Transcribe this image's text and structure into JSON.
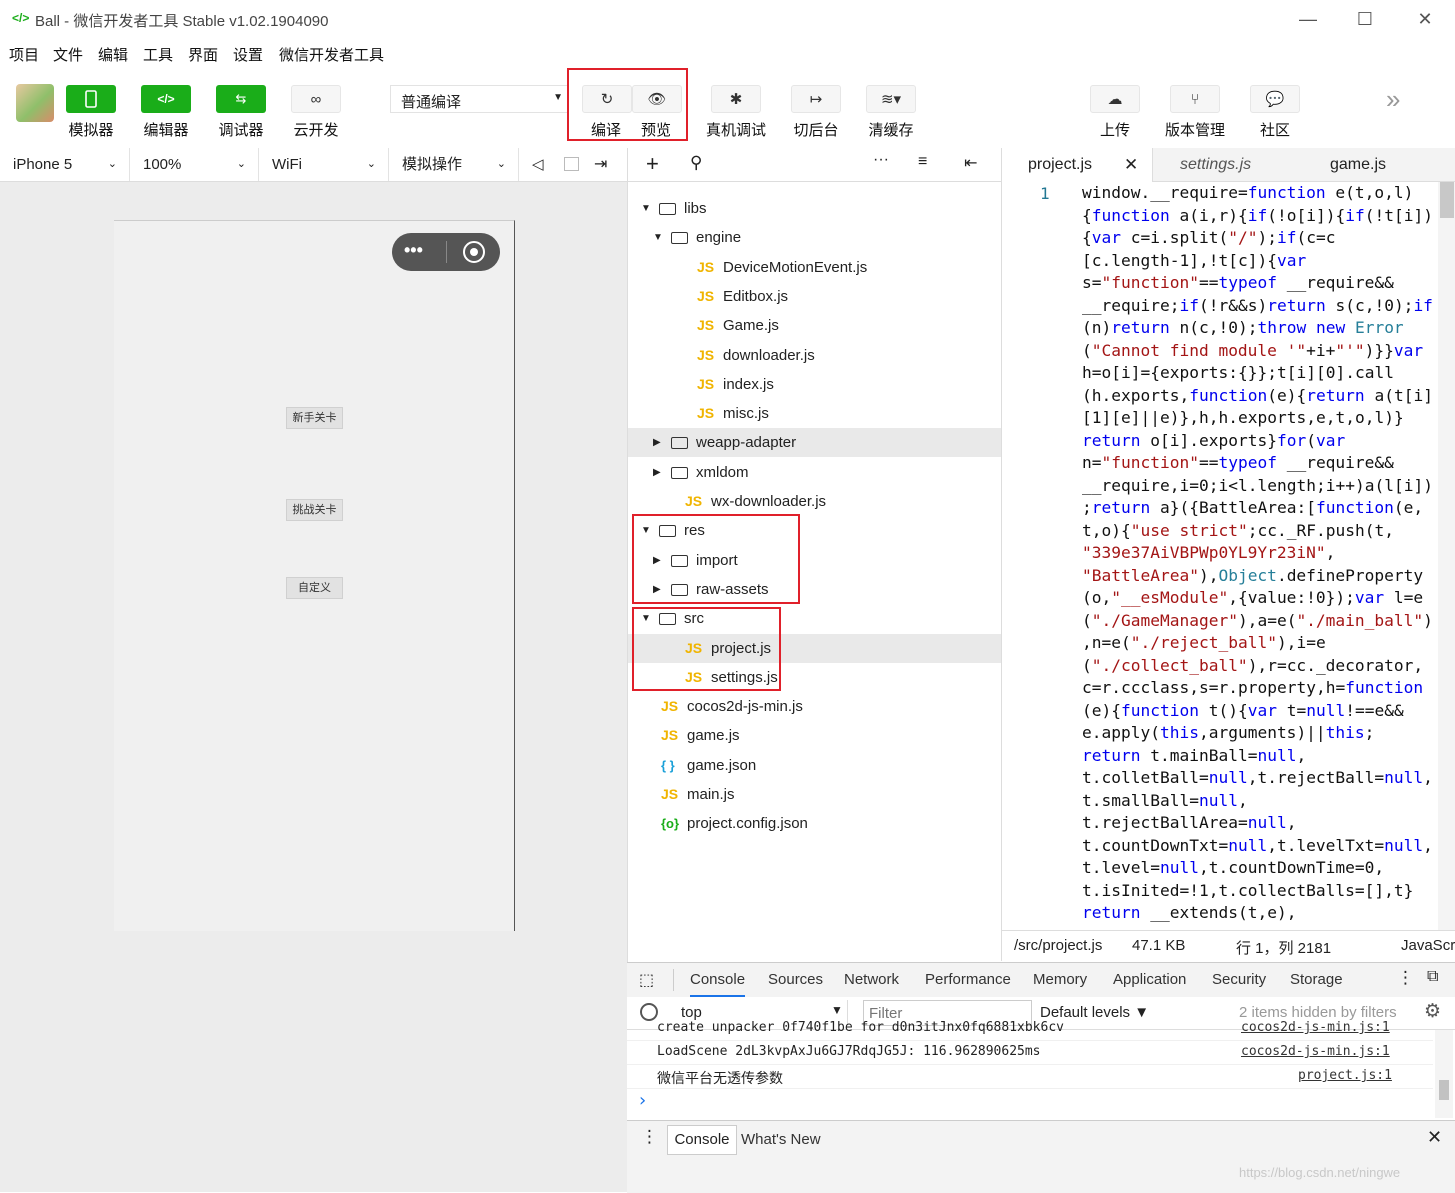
{
  "window": {
    "logo": "</>",
    "title": "Ball - 微信开发者工具 Stable v1.02.1904090",
    "minimize": "—",
    "maximize": "☐",
    "close": "✕"
  },
  "menu": [
    "项目",
    "文件",
    "编辑",
    "工具",
    "界面",
    "设置",
    "微信开发者工具"
  ],
  "toolbar": {
    "simulator": "模拟器",
    "editor": "编辑器",
    "debugger": "调试器",
    "cloud": "云开发",
    "compile_mode": "普通编译",
    "compile": "编译",
    "preview": "预览",
    "remote_debug": "真机调试",
    "background": "切后台",
    "clear_cache": "清缓存",
    "upload": "上传",
    "version": "版本管理",
    "community": "社区",
    "more": "»"
  },
  "simbar": {
    "device": "iPhone 5",
    "zoom": "100%",
    "network": "WiFi",
    "operation": "模拟操作"
  },
  "phone": {
    "capsule_dots": "•••",
    "buttons": [
      "新手关卡",
      "挑战关卡",
      "自定义"
    ]
  },
  "tree": [
    {
      "label": "libs",
      "type": "folder",
      "open": true,
      "depth": 0
    },
    {
      "label": "engine",
      "type": "folder",
      "open": true,
      "depth": 1
    },
    {
      "label": "DeviceMotionEvent.js",
      "type": "js",
      "depth": 2
    },
    {
      "label": "Editbox.js",
      "type": "js",
      "depth": 2
    },
    {
      "label": "Game.js",
      "type": "js",
      "depth": 2
    },
    {
      "label": "downloader.js",
      "type": "js",
      "depth": 2
    },
    {
      "label": "index.js",
      "type": "js",
      "depth": 2
    },
    {
      "label": "misc.js",
      "type": "js",
      "depth": 2
    },
    {
      "label": "weapp-adapter",
      "type": "folder",
      "open": false,
      "depth": 1,
      "highlight": true
    },
    {
      "label": "xmldom",
      "type": "folder",
      "open": false,
      "depth": 1
    },
    {
      "label": "wx-downloader.js",
      "type": "js",
      "depth": 1
    },
    {
      "label": "res",
      "type": "folder",
      "open": true,
      "depth": 0
    },
    {
      "label": "import",
      "type": "folder",
      "open": false,
      "depth": 1
    },
    {
      "label": "raw-assets",
      "type": "folder",
      "open": false,
      "depth": 1
    },
    {
      "label": "src",
      "type": "folder",
      "open": true,
      "depth": 0
    },
    {
      "label": "project.js",
      "type": "js",
      "depth": 1,
      "highlight": true
    },
    {
      "label": "settings.js",
      "type": "js",
      "depth": 1
    },
    {
      "label": "cocos2d-js-min.js",
      "type": "js",
      "depth": 0
    },
    {
      "label": "game.js",
      "type": "js",
      "depth": 0
    },
    {
      "label": "game.json",
      "type": "json",
      "depth": 0
    },
    {
      "label": "main.js",
      "type": "js",
      "depth": 0
    },
    {
      "label": "project.config.json",
      "type": "config",
      "depth": 0
    }
  ],
  "editor": {
    "tabs": [
      "project.js",
      "settings.js",
      "game.js"
    ],
    "line_number": "1",
    "code_lines": [
      "window.__require=function e(t,o,l)",
      "{function a(i,r){if(!o[i]){if(!t[i])",
      "{var c=i.split(\"/\");if(c=c",
      "[c.length-1],!t[c]){var",
      "s=\"function\"==typeof __require&&",
      "__require;if(!r&&s)return s(c,!0);if",
      "(n)return n(c,!0);throw new Error",
      "(\"Cannot find module '\"+i+\"'\")}}var",
      "h=o[i]={exports:{}};t[i][0].call",
      "(h.exports,function(e){return a(t[i]",
      "[1][e]||e)},h,h.exports,e,t,o,l)}",
      "return o[i].exports}for(var",
      "n=\"function\"==typeof __require&&",
      "__require,i=0;i<l.length;i++)a(l[i])",
      ";return a}({BattleArea:[function(e,",
      "t,o){\"use strict\";cc._RF.push(t,",
      "\"339e37AiVBPWp0YL9Yr23iN\",",
      "\"BattleArea\"),Object.defineProperty",
      "(o,\"__esModule\",{value:!0});var l=e",
      "(\"./GameManager\"),a=e(\"./main_ball\")",
      ",n=e(\"./reject_ball\"),i=e",
      "(\"./collect_ball\"),r=cc._decorator,",
      "c=r.ccclass,s=r.property,h=function",
      "(e){function t(){var t=null!==e&&",
      "e.apply(this,arguments)||this;",
      "return t.mainBall=null,",
      "t.colletBall=null,t.rejectBall=null,",
      "t.smallBall=null,",
      "t.rejectBallArea=null,",
      "t.countDownTxt=null,t.levelTxt=null,",
      "t.level=null,t.countDownTime=0,",
      "t.isInited=!1,t.collectBalls=[],t}",
      "return __extends(t,e),"
    ]
  },
  "status": {
    "path": "/src/project.js",
    "size": "47.1 KB",
    "position": "行 1，列 2181",
    "language": "JavaScr"
  },
  "devtools": {
    "tabs": [
      "Console",
      "Sources",
      "Network",
      "Performance",
      "Memory",
      "Application",
      "Security",
      "Storage"
    ],
    "context": "top",
    "filter_placeholder": "Filter",
    "levels": "Default levels ▼",
    "hidden": "2 items hidden by filters",
    "messages": [
      {
        "text": "create unpacker 0f740f1be for d0n3itJnx0fq6881xbk6cv",
        "source": "cocos2d-js-min.js:1"
      },
      {
        "text": "LoadScene 2dL3kvpAxJu6GJ7RdqJG5J: 116.962890625ms",
        "source": "cocos2d-js-min.js:1"
      },
      {
        "text": "微信平台无透传参数",
        "source": "project.js:1"
      }
    ],
    "prompt": "›",
    "drawer_tabs": [
      "Console",
      "What's New"
    ],
    "watermark": "https://blog.csdn.net/ningwe"
  },
  "colors": {
    "accent": "#1aad19",
    "highlight_box": "#e0202a",
    "js_icon": "#f0b400"
  }
}
